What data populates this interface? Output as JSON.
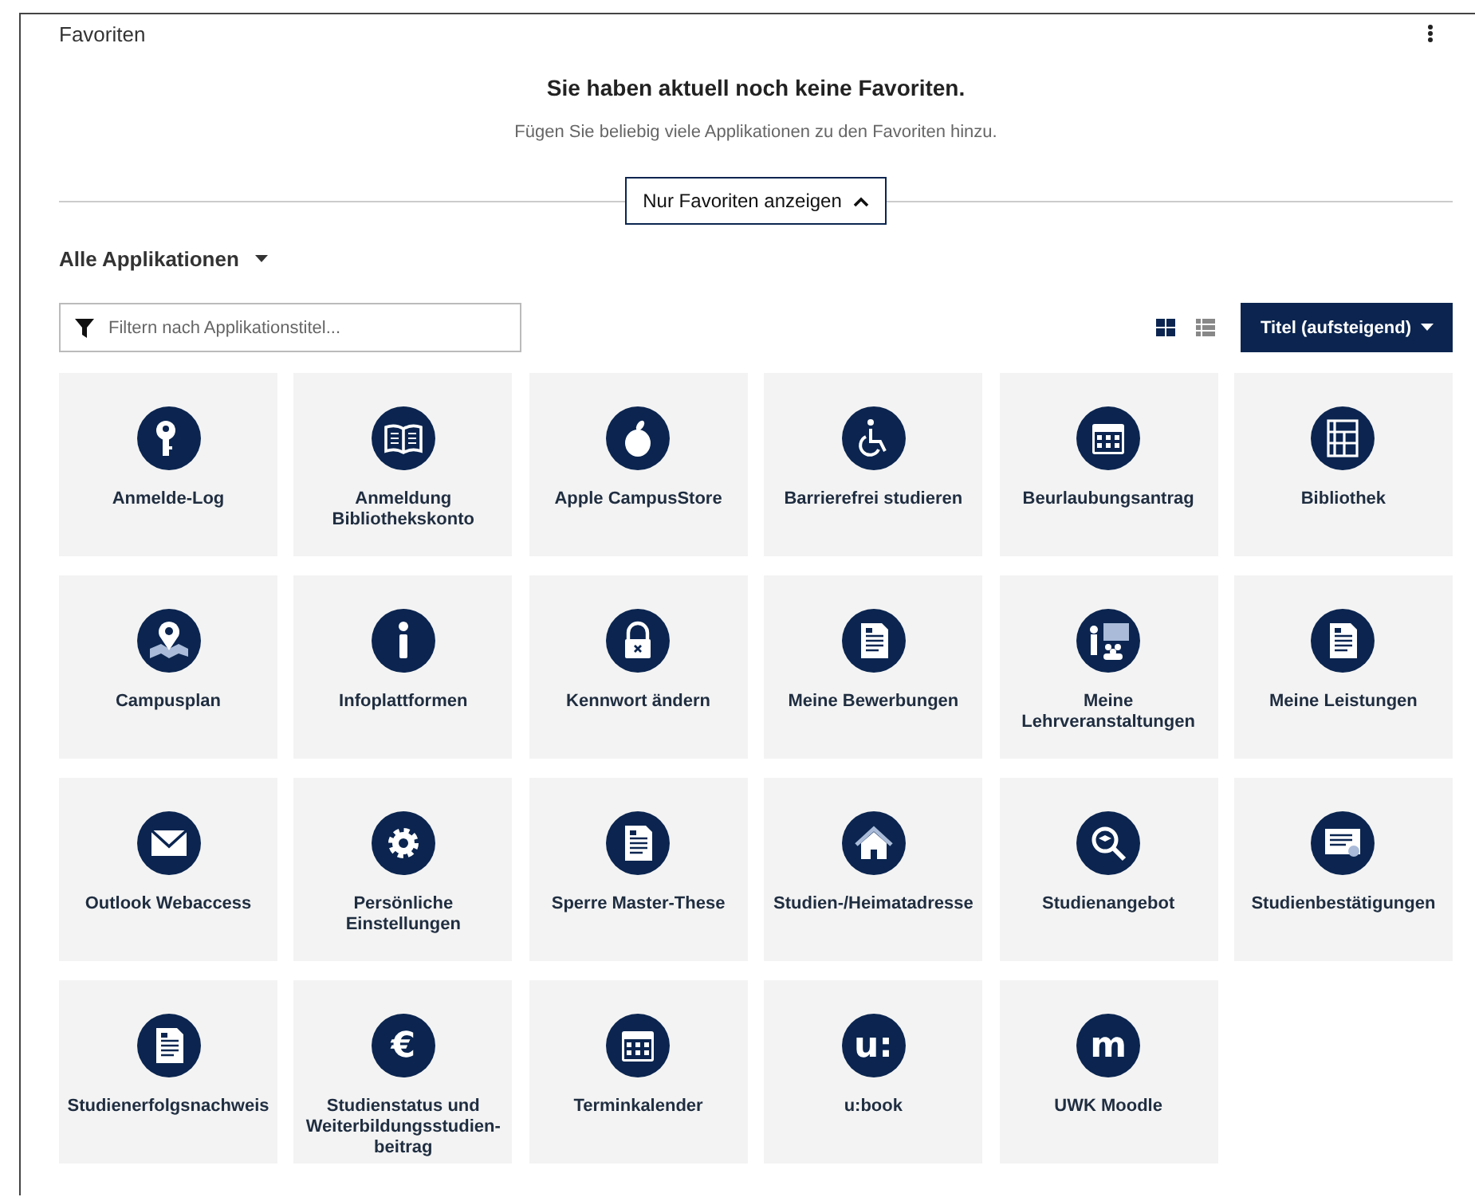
{
  "panel": {
    "title": "Favoriten"
  },
  "empty_state": {
    "heading": "Sie haben aktuell noch keine Favoriten.",
    "text": "Fügen Sie beliebig viele Applikationen zu den Favoriten hinzu."
  },
  "favorites_toggle": {
    "label": "Nur Favoriten anzeigen",
    "expanded": true
  },
  "section": {
    "title": "Alle Applikationen"
  },
  "filter": {
    "placeholder": "Filtern nach Applikationstitel..."
  },
  "view_modes": [
    {
      "kind": "grid",
      "selected": true
    },
    {
      "kind": "list",
      "selected": false
    }
  ],
  "sort": {
    "label": "Titel (aufsteigend)"
  },
  "apps": [
    {
      "title": "Anmelde-Log",
      "kind": "key"
    },
    {
      "title": "Anmeldung Bibliothekskonto",
      "kind": "book"
    },
    {
      "title": "Apple CampusStore",
      "kind": "apple"
    },
    {
      "title": "Barrierefrei studieren",
      "kind": "wheelchair"
    },
    {
      "title": "Beurlaubungsantrag",
      "kind": "calendar"
    },
    {
      "title": "Bibliothek",
      "kind": "shelf"
    },
    {
      "title": "Campusplan",
      "kind": "map"
    },
    {
      "title": "Infoplattformen",
      "kind": "info"
    },
    {
      "title": "Kennwort ändern",
      "kind": "lock"
    },
    {
      "title": "Meine Bewerbungen",
      "kind": "document"
    },
    {
      "title": "Meine Lehrveranstaltungen",
      "kind": "teacher"
    },
    {
      "title": "Meine Leistungen",
      "kind": "document"
    },
    {
      "title": "Outlook Webaccess",
      "kind": "envelope"
    },
    {
      "title": "Persönliche Einstellungen",
      "kind": "gear"
    },
    {
      "title": "Sperre Master-These",
      "kind": "document"
    },
    {
      "title": "Studien-/Heimatadresse",
      "kind": "house"
    },
    {
      "title": "Studienangebot",
      "kind": "search"
    },
    {
      "title": "Studienbestätigungen",
      "kind": "certificate"
    },
    {
      "title": "Studienerfolgsnachweis",
      "kind": "document"
    },
    {
      "title": "Studienstatus und Weiterbildungsstudien-beitrag",
      "kind": "glyph",
      "glyph": "€"
    },
    {
      "title": "Terminkalender",
      "kind": "calendar"
    },
    {
      "title": "u:book",
      "kind": "glyph",
      "glyph": "u:"
    },
    {
      "title": "UWK Moodle",
      "kind": "glyph",
      "glyph": "m"
    }
  ]
}
